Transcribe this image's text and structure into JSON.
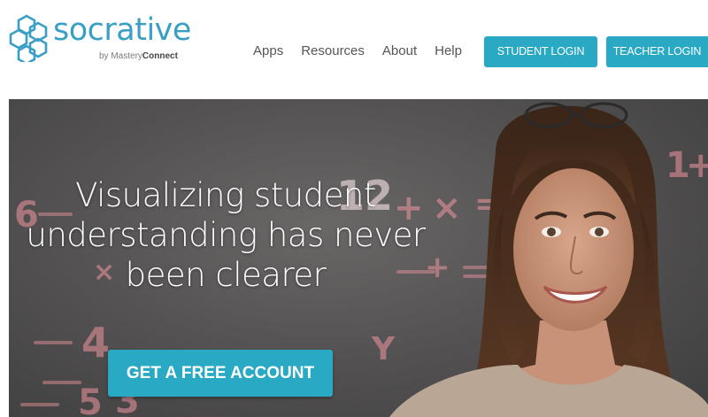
{
  "brand": {
    "name": "socrative",
    "by_prefix": "by Mastery",
    "by_bold": "Connect",
    "color": "#3a9fc4"
  },
  "nav": {
    "items": [
      "Apps",
      "Resources",
      "About",
      "Help"
    ]
  },
  "auth": {
    "student_login": "STUDENT LOGIN",
    "teacher_login": "TEACHER LOGIN",
    "button_color": "#29a9c3"
  },
  "hero": {
    "headline_lines": [
      "Visualizing student",
      "understanding has never",
      "been clearer"
    ],
    "cta_label": "GET A FREE ACCOUNT",
    "chalk_marks": [
      "6",
      "12",
      "+",
      "×",
      "=",
      "4",
      "5",
      "3",
      "+",
      "×",
      "Y",
      "1",
      "+"
    ]
  }
}
